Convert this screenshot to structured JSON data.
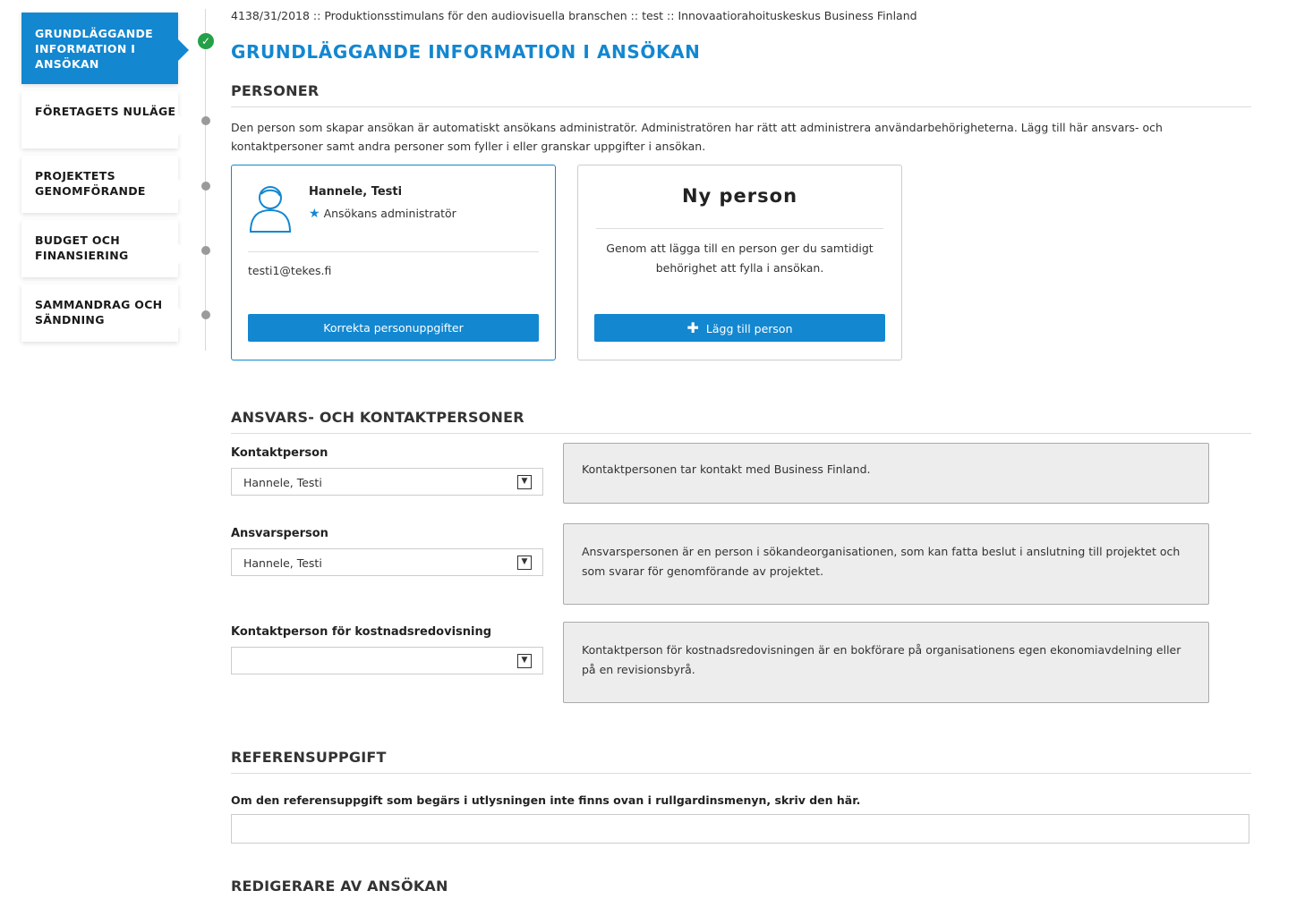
{
  "sidebar": {
    "steps": [
      {
        "label": "Grundläggande information i ansökan"
      },
      {
        "label": "Företagets nuläge"
      },
      {
        "label": "Projektets genomförande"
      },
      {
        "label": "Budget och finansiering"
      },
      {
        "label": "Sammandrag och sändning"
      }
    ]
  },
  "header": {
    "breadcrumb": "4138/31/2018 :: Produktionsstimulans för den audiovisuella branschen :: test :: Innovaatiorahoituskeskus Business Finland",
    "title": "GRUNDLÄGGANDE INFORMATION I ANSÖKAN"
  },
  "persons": {
    "section_title": "PERSONER",
    "description": "Den person som skapar ansökan är automatiskt ansökans administratör. Administratören har rätt att administrera användarbehörigheterna. Lägg till här ansvars- och kontaktpersoner samt andra personer som fyller i eller granskar uppgifter i ansökan.",
    "card": {
      "name": "Hannele, Testi",
      "role": "Ansökans administratör",
      "email": "testi1@tekes.fi",
      "button": "Korrekta personuppgifter"
    },
    "new_card": {
      "title": "Ny person",
      "description": "Genom att lägga till en person ger du samtidigt behörighet att fylla i ansökan.",
      "button": "Lägg till person"
    }
  },
  "contacts": {
    "section_title": "ANSVARS- OCH KONTAKTPERSONER",
    "fields": [
      {
        "label": "Kontaktperson",
        "value": "Hannele, Testi",
        "help": "Kontaktpersonen tar kontakt med Business Finland."
      },
      {
        "label": "Ansvarsperson",
        "value": "Hannele, Testi",
        "help": "Ansvarspersonen är en person i sökandeorganisationen, som kan fatta beslut i anslutning till projektet och som svarar för genomförande av projektet."
      },
      {
        "label": "Kontaktperson för kostnadsredovisning",
        "value": "",
        "help": "Kontaktperson för kostnadsredovisningen är en bokförare på organisationens egen ekonomiavdelning eller på en revisionsbyrå."
      }
    ]
  },
  "reference": {
    "section_title": "REFERENSUPPGIFT",
    "question": "Om den referensuppgift som begärs i utlysningen inte finns ovan i rullgardinsmenyn, skriv den här.",
    "value": ""
  },
  "editors": {
    "section_title": "REDIGERARE AV ANSÖKAN"
  },
  "colors": {
    "accent": "#1387d0",
    "success": "#24a148",
    "panel": "#ededed"
  }
}
